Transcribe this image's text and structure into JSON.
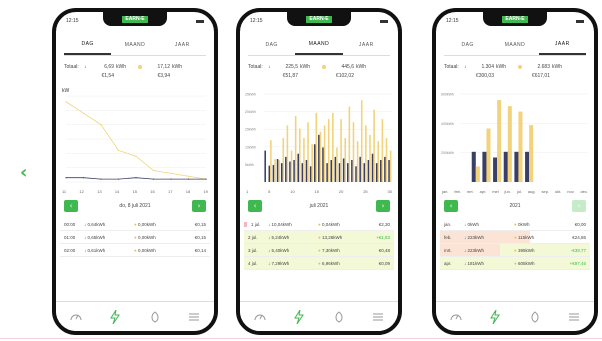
{
  "brand": "EARN-E",
  "status_time": "12:15",
  "tabs": [
    "DAG",
    "MAAND",
    "JAAR"
  ],
  "screens": [
    {
      "active_tab": "DAG",
      "totals": {
        "label": "Totaal:",
        "consumption_kwh": "6,69",
        "injection_kwh": "17,12",
        "unit": "kWh",
        "consumption_eur": "€1,54",
        "injection_eur": "€3,94"
      },
      "chart_label": "kW",
      "x_ticks": [
        "11",
        "12",
        "13",
        "14",
        "15",
        "16",
        "17",
        "18",
        "19"
      ],
      "date_label": "do, 8 juli 2021",
      "rows": [
        {
          "time": "00:00",
          "consumption": "0,64kWh",
          "injection": "0,00kWh",
          "amount": "€0,15"
        },
        {
          "time": "01:00",
          "consumption": "0,65kWh",
          "injection": "0,00kWh",
          "amount": "€0,15"
        },
        {
          "time": "02:00",
          "consumption": "0,61kWh",
          "injection": "0,00kWh",
          "amount": "€0,14"
        }
      ]
    },
    {
      "active_tab": "MAAND",
      "totals": {
        "label": "Totaal:",
        "consumption_kwh": "225,5",
        "injection_kwh": "445,6",
        "unit": "kWh",
        "consumption_eur": "€51,87",
        "injection_eur": "€102,02"
      },
      "y_ticks": [
        "25kWh",
        "20kWh",
        "15kWh",
        "10kWh",
        "5kWh"
      ],
      "x_ticks": [
        "1",
        "5",
        "10",
        "15",
        "20",
        "25",
        "30"
      ],
      "date_label": "juli 2021",
      "rows": [
        {
          "time": "1 jul.",
          "consumption": "10,04kWh",
          "injection": "0,04kWh",
          "amount": "€2,30"
        },
        {
          "time": "2 jul.",
          "consumption": "5,24kWh",
          "injection": "13,26kWh",
          "amount": "+€1,83"
        },
        {
          "time": "3 jul.",
          "consumption": "5,40kWh",
          "injection": "7,30kWh",
          "amount": "€0,48"
        },
        {
          "time": "4 jul.",
          "consumption": "7,29kWh",
          "injection": "6,96kWh",
          "amount": "€0,09"
        }
      ]
    },
    {
      "active_tab": "JAAR",
      "totals": {
        "label": "Totaal:",
        "consumption_kwh": "1.304",
        "injection_kwh": "2.683",
        "unit": "kWh",
        "consumption_eur": "€300,03",
        "injection_eur": "€617,01"
      },
      "y_ticks": [
        "600kWh",
        "400kWh",
        "200kWh"
      ],
      "x_ticks": [
        "jan.",
        "feb.",
        "mrt.",
        "apr.",
        "mei",
        "jun.",
        "jul.",
        "aug.",
        "sep.",
        "okt.",
        "nov.",
        "dec."
      ],
      "date_label": "2021",
      "rows": [
        {
          "time": "jan.",
          "consumption": "0kWh",
          "injection": "0kWh",
          "amount": "€0,00"
        },
        {
          "time": "feb.",
          "consumption": "223kWh",
          "injection": "115kWh",
          "amount": "€24,86"
        },
        {
          "time": "mrt.",
          "consumption": "223kWh",
          "injection": "395kWh",
          "amount": "-€39,77"
        },
        {
          "time": "apr.",
          "consumption": "181kWh",
          "injection": "605kWh",
          "amount": "+€97,46"
        }
      ]
    }
  ],
  "colors": {
    "accent": "#3fb94f",
    "consumption": "#3a3f66",
    "injection": "#f2d27a"
  },
  "chart_data": [
    {
      "type": "line",
      "ylabel": "kW",
      "x": [
        "11",
        "12",
        "13",
        "14",
        "15",
        "16",
        "17",
        "18",
        "19"
      ],
      "series": [
        {
          "values": [
            5.6,
            4.8,
            4.0,
            2.2,
            1.8,
            0.8,
            0.6,
            0.4,
            0.2
          ]
        },
        {
          "values": [
            0.3,
            0.3,
            0.2,
            0.2,
            0.3,
            0.2,
            0.2,
            0.2,
            0.2
          ]
        }
      ]
    },
    {
      "type": "bar",
      "categories": [
        "1",
        "2",
        "3",
        "4",
        "5",
        "6",
        "7",
        "8",
        "9",
        "10",
        "11",
        "12",
        "13",
        "14",
        "15",
        "16",
        "17",
        "18",
        "19",
        "20",
        "21",
        "22",
        "23",
        "24",
        "25",
        "26",
        "27",
        "28",
        "29",
        "30",
        "31"
      ],
      "series": [
        {
          "values": [
            10.0,
            5.2,
            5.4,
            7.3,
            6.0,
            8.0,
            6.5,
            7.0,
            9.0,
            6.0,
            7.0,
            5.0,
            12.0,
            15.0,
            11.0,
            6.0,
            7.0,
            8.0,
            6.0,
            7.5,
            6.0,
            7.0,
            5.0,
            8.0,
            6.0,
            7.0,
            9.0,
            6.0,
            7.0,
            8.0,
            7.0
          ]
        },
        {
          "values": [
            0.0,
            13.3,
            7.3,
            7.0,
            14.0,
            18.0,
            10.0,
            21.0,
            17.0,
            14.0,
            19.0,
            12.0,
            22.0,
            16.0,
            18.0,
            20.0,
            22.0,
            11.0,
            20.0,
            14.0,
            24.0,
            19.0,
            13.0,
            26.0,
            18.0,
            15.0,
            23.0,
            13.0,
            20.0,
            14.0,
            10.0
          ]
        }
      ],
      "ylim": [
        0,
        28
      ]
    },
    {
      "type": "bar",
      "categories": [
        "jan.",
        "feb.",
        "mrt.",
        "apr.",
        "mei",
        "jun.",
        "jul.",
        "aug.",
        "sep.",
        "okt.",
        "nov.",
        "dec."
      ],
      "series": [
        {
          "values": [
            0,
            223,
            223,
            181,
            223,
            223,
            223,
            0,
            0,
            0,
            0,
            0
          ]
        },
        {
          "values": [
            0,
            115,
            395,
            605,
            560,
            520,
            420,
            0,
            0,
            0,
            0,
            0
          ]
        }
      ],
      "ylim": [
        0,
        650
      ]
    }
  ],
  "nav": {
    "left_arrow": "‹",
    "prev": "‹",
    "next": "›"
  }
}
